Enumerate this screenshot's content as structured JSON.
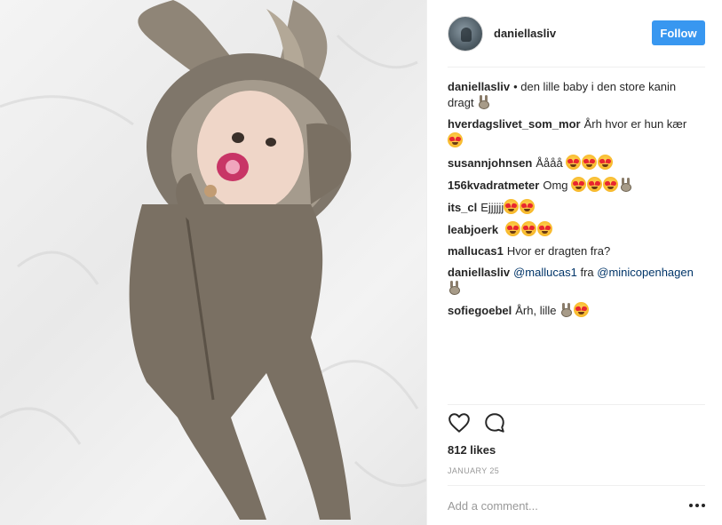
{
  "post": {
    "photo_alt": "",
    "author": "daniellasliv",
    "follow_label": "Follow",
    "caption": {
      "author": "daniellasliv",
      "text": "• den lille baby i den store kanin dragt",
      "emoji": [
        "rabbit-emoji"
      ]
    },
    "comments": [
      {
        "author": "hverdagslivet_som_mor",
        "text": "Årh hvor er hun kær",
        "emoji": [
          "heart-eyes-emoji"
        ]
      },
      {
        "author": "susannjohnsen",
        "text": "Åååå",
        "emoji": [
          "heart-eyes-emoji",
          "heart-eyes-emoji",
          "heart-eyes-emoji"
        ]
      },
      {
        "author": "156kvadratmeter",
        "text": "Omg",
        "emoji": [
          "heart-eyes-emoji",
          "heart-eyes-emoji",
          "heart-eyes-emoji",
          "rabbit-emoji"
        ]
      },
      {
        "author": "its_cl",
        "text": "Ejjjjjj",
        "emoji": [
          "heart-eyes-emoji",
          "heart-eyes-emoji"
        ]
      },
      {
        "author": "leabjoerk",
        "text": "",
        "emoji": [
          "heart-eyes-emoji",
          "heart-eyes-emoji",
          "heart-eyes-emoji"
        ]
      },
      {
        "author": "mallucas1",
        "text": "Hvor er dragten fra?",
        "emoji": []
      },
      {
        "author": "daniellasliv",
        "mention1": "@mallucas1",
        "mid": "fra",
        "mention2": "@minicopenhagen",
        "emoji": [
          "rabbit-emoji"
        ]
      },
      {
        "author": "sofiegoebel",
        "text": "Årh, lille",
        "emoji": [
          "rabbit-emoji",
          "heart-eyes-emoji"
        ]
      }
    ],
    "likes": "812 likes",
    "date": "JANUARY 25",
    "add_comment_placeholder": "Add a comment...",
    "icons": {
      "like": "heart-icon",
      "comment": "comment-bubble-icon",
      "more": "more-options-icon"
    },
    "colors": {
      "follow_bg": "#3897f0",
      "mention": "#003569",
      "muted": "#999999",
      "text": "#262626"
    }
  }
}
